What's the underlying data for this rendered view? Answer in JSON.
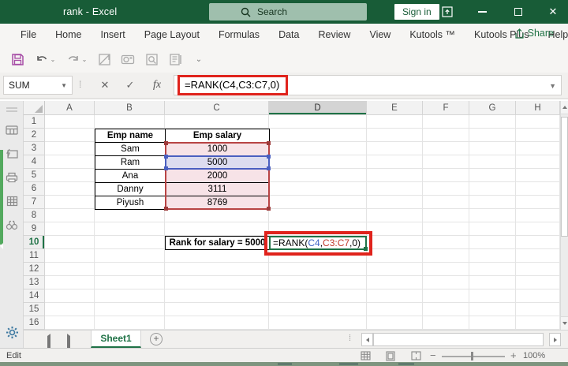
{
  "window": {
    "title": "rank - Excel",
    "search_placeholder": "Search",
    "sign_in_label": "Sign in"
  },
  "ribbon": {
    "tabs": [
      "File",
      "Home",
      "Insert",
      "Page Layout",
      "Formulas",
      "Data",
      "Review",
      "View",
      "Kutools ™",
      "Kutools Plus",
      "Help"
    ],
    "share_label": "Share"
  },
  "quick_access": {
    "icons": [
      "save-icon",
      "undo-icon",
      "redo-icon",
      "draw-table-icon",
      "camera-icon",
      "print-preview-icon",
      "document-properties-icon",
      "customize-toolbar-icon"
    ]
  },
  "formula_bar": {
    "name_box_value": "SUM",
    "formula": "=RANK(C4,C3:C7,0)"
  },
  "grid": {
    "column_letters": [
      "A",
      "B",
      "C",
      "D",
      "E",
      "F",
      "G",
      "H"
    ],
    "row_numbers": [
      "1",
      "2",
      "3",
      "4",
      "5",
      "6",
      "7",
      "8",
      "9",
      "10",
      "11",
      "12",
      "13",
      "14",
      "15",
      "16"
    ],
    "selected_column": "D",
    "selected_row": "10"
  },
  "emp_table": {
    "headers": [
      "Emp name",
      "Emp salary"
    ],
    "rows": [
      [
        "Sam",
        "1000"
      ],
      [
        "Ram",
        "5000"
      ],
      [
        "Ana",
        "2000"
      ],
      [
        "Danny",
        "3111"
      ],
      [
        "Piyush",
        "8769"
      ]
    ]
  },
  "rank_row": {
    "label": "Rank for salary = 5000",
    "formula_parts": [
      {
        "text": "=RANK(",
        "color": "#000000"
      },
      {
        "text": "C4",
        "color": "#3E63C4"
      },
      {
        "text": ",",
        "color": "#000000"
      },
      {
        "text": "C3:C7",
        "color": "#C0392B"
      },
      {
        "text": ",0)",
        "color": "#000000"
      }
    ]
  },
  "sheet_bar": {
    "active_sheet": "Sheet1"
  },
  "status_bar": {
    "mode": "Edit",
    "zoom_level": "100%"
  },
  "colors": {
    "titlebar_green": "#185C37",
    "accent_green": "#1F7246",
    "annotation_red": "#E0231C",
    "range_fill_pink": "#F7E3E7",
    "cell_fill_lavender": "#DCDCEF",
    "range_border_red": "#B84444",
    "cell_border_blue": "#4A5FC0"
  }
}
